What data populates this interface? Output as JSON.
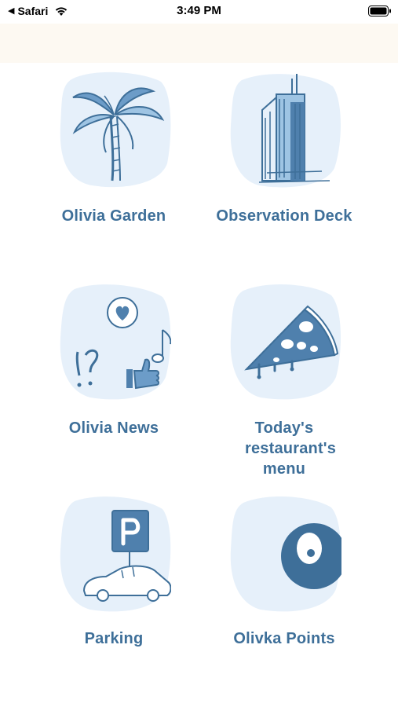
{
  "status_bar": {
    "back_glyph": "◀",
    "carrier": "Safari",
    "wifi_icon": "wifi-icon",
    "time": "3:49 PM",
    "battery_icon": "battery-icon"
  },
  "colors": {
    "label": "#3e6f99",
    "blob": "#e6f0fa",
    "art_primary": "#3e6f99",
    "art_light": "#9ec4e3",
    "header_band": "#fdf9f2"
  },
  "tiles": [
    {
      "label": "Olivia Garden",
      "icon": "palm-tree-icon"
    },
    {
      "label": "Observation Deck",
      "icon": "skyscraper-icon"
    },
    {
      "label": "Olivia News",
      "icon": "news-icon"
    },
    {
      "label": "Today's restaurant's menu",
      "icon": "pizza-icon"
    },
    {
      "label": "Parking",
      "icon": "parking-icon"
    },
    {
      "label": "Olivka Points",
      "icon": "points-icon"
    }
  ]
}
